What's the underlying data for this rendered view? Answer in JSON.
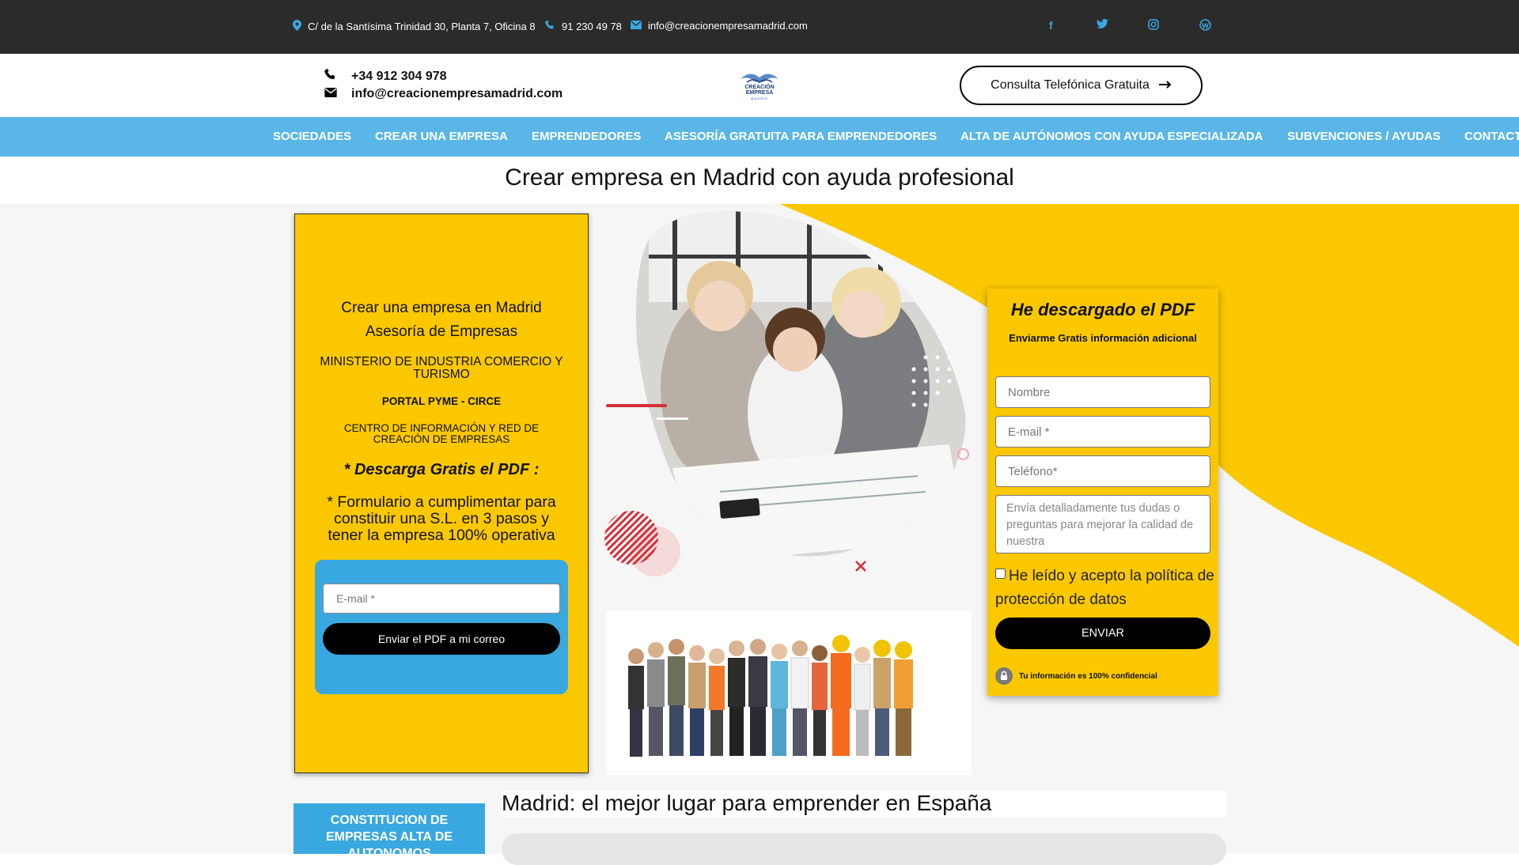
{
  "topbar": {
    "address": "C/ de la Santísima Trinidad 30, Planta 7, Oficina 8",
    "phone": "91 230 49 78",
    "email": "info@creacionempresamadrid.com",
    "social": [
      "facebook-icon",
      "twitter-icon",
      "instagram-icon",
      "wordpress-icon"
    ]
  },
  "header": {
    "phone": "+34 912 304 978",
    "email": "info@creacionempresamadrid.com",
    "logo_line1": "CREACIÓN",
    "logo_line2": "EMPRESA",
    "logo_line3": "MADRID",
    "cta_label": "Consulta Telefónica Gratuita"
  },
  "nav": {
    "items": [
      "SOCIEDADES",
      "CREAR UNA EMPRESA",
      "EMPRENDEDORES",
      "ASESORÍA GRATUITA PARA EMPRENDEDORES",
      "ALTA DE AUTÓNOMOS CON AYUDA ESPECIALIZADA",
      "SUBVENCIONES / AYUDAS",
      "CONTACTO"
    ]
  },
  "page_title": "Crear empresa en Madrid con ayuda profesional",
  "left_box": {
    "line1": "Crear una empresa en Madrid",
    "line2": "Asesoría de Empresas",
    "ministry": "MINISTERIO DE INDUSTRIA COMERCIO Y TURISMO",
    "portal": "PORTAL PYME - CIRCE",
    "centro": "CENTRO DE INFORMACIÓN Y RED DE CREACIÓN DE EMPRESAS",
    "pdf_heading": "* Descarga Gratis el PDF :",
    "description": "* Formulario a cumplimentar para constituir una S.L. en 3 pasos y tener la empresa 100% operativa",
    "email_placeholder": "E-mail *",
    "send_button": "Enviar el PDF a mi correo"
  },
  "form": {
    "title": "He descargado el PDF",
    "subtitle": "Enviarme Gratis información adicional",
    "name_placeholder": "Nombre",
    "email_placeholder": "E-mail *",
    "phone_placeholder": "Teléfono*",
    "message_placeholder": "Envía detalladamente tus dudas o preguntas para mejorar la calidad de nuestra",
    "privacy_label": "He leído y acepto la política de protección de datos",
    "submit_label": "ENVIAR",
    "confidential": "Tu información es 100% confidencial"
  },
  "bottom": {
    "side_box": "CONSTITUCION DE EMPRESAS ALTA DE AUTONOMOS",
    "section_title": "Madrid: el mejor lugar para emprender en España"
  },
  "colors": {
    "topbar": "#2b2b2b",
    "accent_blue": "#3aa8e0",
    "nav": "#5ab6e6",
    "yellow": "#fbc800",
    "red": "#d32f3a"
  }
}
